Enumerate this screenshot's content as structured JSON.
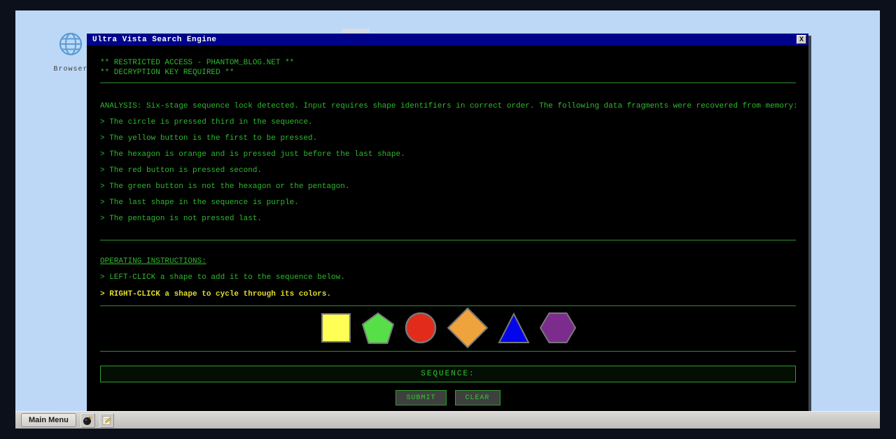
{
  "desktop": {
    "icon": {
      "label": "Browser"
    }
  },
  "window": {
    "title": "Ultra Vista Search Engine",
    "close_label": "X",
    "banner_line1": "** RESTRICTED ACCESS - PHANTOM_BLOG.NET **",
    "banner_line2": "** DECRYPTION KEY REQUIRED **",
    "analysis": "ANALYSIS: Six-stage sequence lock detected. Input requires shape identifiers in correct order. The following data fragments were recovered from memory:",
    "clues": [
      "> The circle is pressed third in the sequence.",
      "> The yellow button is the first to be pressed.",
      "> The hexagon is orange and is pressed just before the last shape.",
      "> The red button is pressed second.",
      "> The green button is not the hexagon or the pentagon.",
      "> The last shape in the sequence is purple.",
      "> The pentagon is not pressed last."
    ],
    "instructions_title": "OPERATING INSTRUCTIONS:",
    "instruction_left_click": "> LEFT-CLICK a shape to add it to the sequence below.",
    "instruction_right_click": "> RIGHT-CLICK a shape to cycle through its colors.",
    "shapes": [
      {
        "name": "square",
        "color": "#ffff55"
      },
      {
        "name": "pentagon",
        "color": "#57df49"
      },
      {
        "name": "circle",
        "color": "#e22b1b"
      },
      {
        "name": "diamond",
        "color": "#f0a33c"
      },
      {
        "name": "triangle",
        "color": "#0505ec"
      },
      {
        "name": "hexagon",
        "color": "#7c2c8d"
      }
    ],
    "sequence_label": "SEQUENCE:",
    "submit_label": "SUBMIT",
    "clear_label": "CLEAR"
  },
  "taskbar": {
    "main_menu_label": "Main Menu",
    "icons": [
      "bomb-icon",
      "notepad-pencil-icon"
    ]
  },
  "theme": {
    "terminal_green": "#2eb82e",
    "highlight_yellow": "#e0dc30",
    "title_bar_blue": "#00038a",
    "desktop_blue": "#bdd8f7",
    "taskbar_gray": "#c9c7c4",
    "shape_stroke_gray": "#787878"
  }
}
